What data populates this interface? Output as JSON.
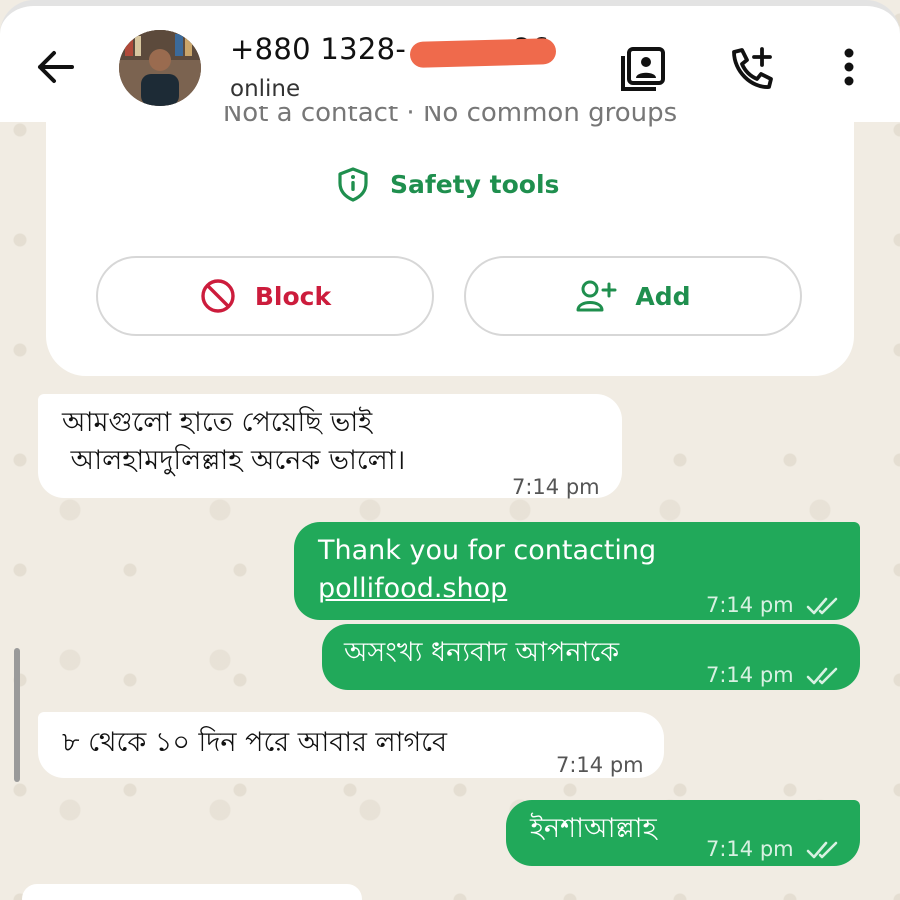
{
  "header": {
    "contact_name": "+880 1328-",
    "contact_name_tail": "86",
    "status": "online"
  },
  "info_card": {
    "subtitle": "Not a contact · No common groups",
    "safety_tools": "Safety tools",
    "block_label": "Block",
    "add_label": "Add"
  },
  "messages": [
    {
      "direction": "in",
      "lines": [
        "আমগুলো হাতে পেয়েছি ভাই",
        " আলহামদুলিল্লাহ অনেক ভালো।"
      ],
      "time": "7:14 pm"
    },
    {
      "direction": "out",
      "lines": [
        "Thank you for contacting",
        "pollifood.shop"
      ],
      "time": "7:14 pm"
    },
    {
      "direction": "out",
      "lines": [
        "অসংখ্য ধন্যবাদ আপনাকে"
      ],
      "time": "7:14 pm"
    },
    {
      "direction": "in",
      "lines": [
        "৮ থেকে ১০ দিন পরে আবার লাগবে"
      ],
      "time": "7:14 pm"
    },
    {
      "direction": "out",
      "lines": [
        "ইনশাআল্লাহ"
      ],
      "time": "7:14 pm"
    }
  ],
  "colors": {
    "accent_green": "#21a95a",
    "safety_green": "#1f8f4e",
    "block_red": "#cc1c3c",
    "read_ticks": "#d8f1e2"
  },
  "icons": [
    "back-arrow-icon",
    "media-gallery-icon",
    "add-call-icon",
    "more-vert-icon",
    "shield-info-icon",
    "block-icon",
    "add-person-icon",
    "double-check-icon"
  ]
}
